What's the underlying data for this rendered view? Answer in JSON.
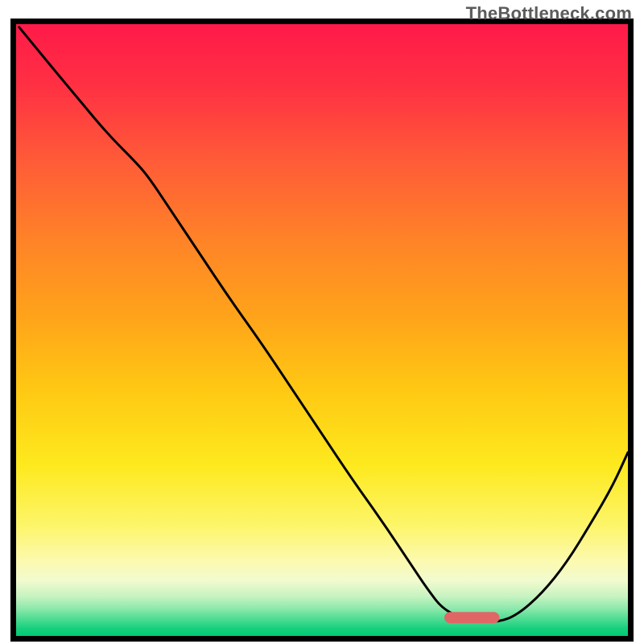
{
  "watermark": "TheBottleneck.com",
  "chart_data": {
    "type": "line",
    "title": "",
    "xlabel": "",
    "ylabel": "",
    "xlim": [
      0,
      100
    ],
    "ylim": [
      0,
      100
    ],
    "note": "Bottleneck-style curve. x is normalized horizontal position 0–100, y is normalized vertical position where 0 = bottom (green, good) and 100 = top (red, bad). The curve descends from top-left, inflects near x≈22, continues down to a flat minimum around x≈70–79 at y≈2–3, then rises toward the right edge to y≈30.",
    "marker": {
      "x_start": 70,
      "x_end": 79,
      "y": 3,
      "color": "#e06666"
    },
    "series": [
      {
        "name": "bottleneck-curve",
        "x": [
          0.5,
          5,
          10,
          15,
          20,
          22,
          25,
          30,
          35,
          40,
          45,
          50,
          55,
          60,
          65,
          67,
          70,
          75,
          79,
          82,
          86,
          90,
          94,
          97.5,
          100
        ],
        "values": [
          99.5,
          94,
          88,
          82,
          77,
          74.5,
          70,
          62.5,
          55,
          48,
          40.5,
          33,
          25.5,
          18.5,
          11,
          8,
          4,
          2.3,
          2.3,
          3.5,
          7,
          12,
          18.5,
          24.5,
          30
        ]
      }
    ],
    "gradient_stops": [
      {
        "offset": 0.0,
        "color": "#ff1a49"
      },
      {
        "offset": 0.1,
        "color": "#ff3043"
      },
      {
        "offset": 0.22,
        "color": "#ff5a38"
      },
      {
        "offset": 0.35,
        "color": "#ff8228"
      },
      {
        "offset": 0.48,
        "color": "#ffa41a"
      },
      {
        "offset": 0.6,
        "color": "#ffc913"
      },
      {
        "offset": 0.72,
        "color": "#fde91e"
      },
      {
        "offset": 0.82,
        "color": "#fdf56a"
      },
      {
        "offset": 0.88,
        "color": "#fcfab2"
      },
      {
        "offset": 0.91,
        "color": "#f0fbcf"
      },
      {
        "offset": 0.935,
        "color": "#c8f3c1"
      },
      {
        "offset": 0.955,
        "color": "#8ee9ac"
      },
      {
        "offset": 0.972,
        "color": "#4fdc93"
      },
      {
        "offset": 0.988,
        "color": "#16d07e"
      },
      {
        "offset": 1.0,
        "color": "#00c974"
      }
    ],
    "frame_color": "#000000",
    "frame_width": 7,
    "curve_color": "#000000",
    "curve_width": 3
  }
}
